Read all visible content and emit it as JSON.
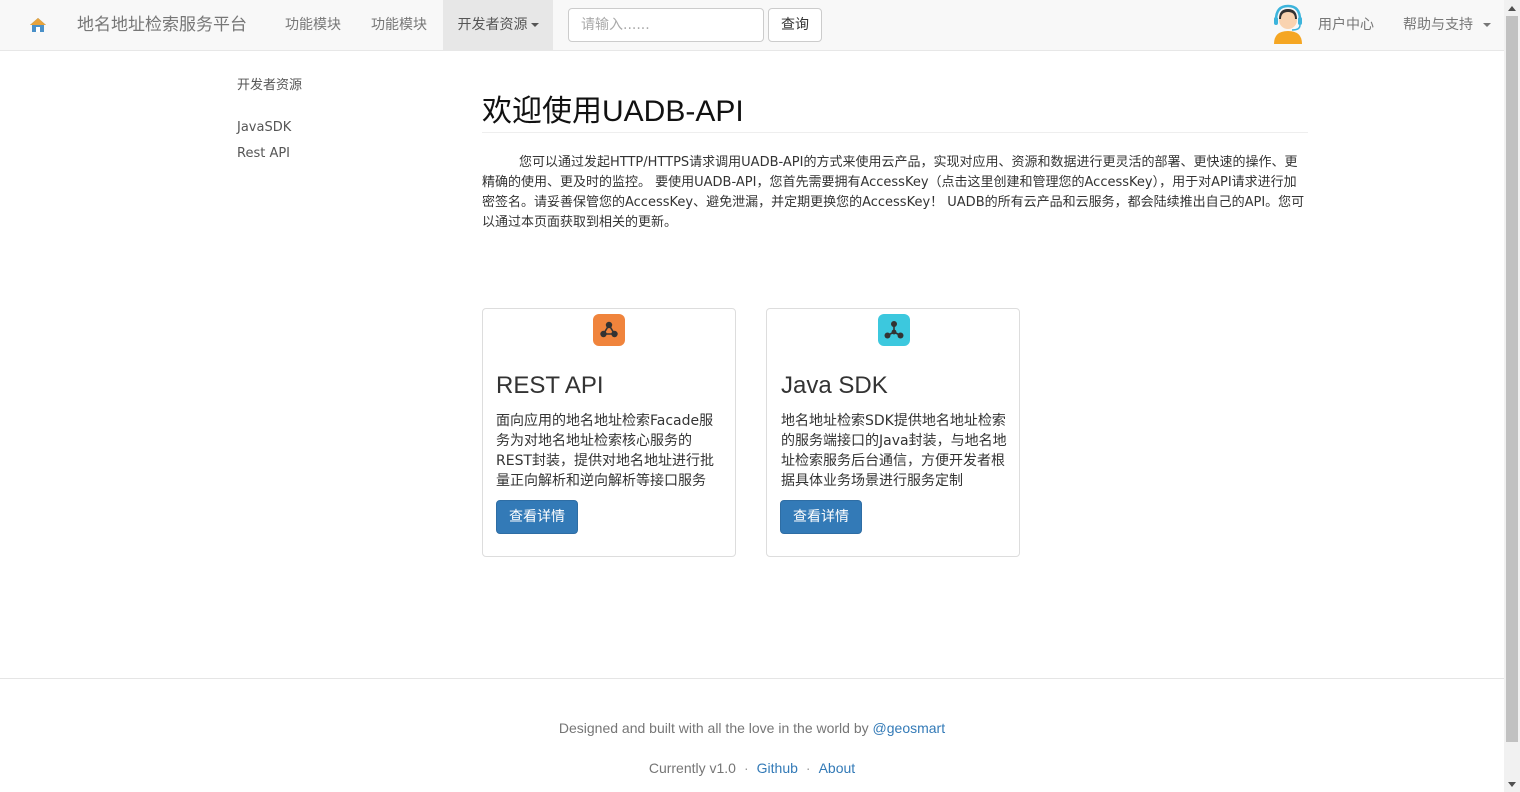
{
  "navbar": {
    "home_icon": "home-icon",
    "brand": "地名地址检索服务平台",
    "links": [
      "功能模块",
      "功能模块"
    ],
    "dev_resources": "开发者资源",
    "search_placeholder": "请输入......",
    "query_button": "查询",
    "avatar_icon": "user-support-avatar-icon",
    "user_center": "用户中心",
    "help": "帮助与支持"
  },
  "sidebar": {
    "title": "开发者资源",
    "items": [
      {
        "label": "JavaSDK"
      },
      {
        "label": "Rest API"
      }
    ]
  },
  "main": {
    "title": "欢迎使用UADB-API",
    "intro": "您可以通过发起HTTP/HTTPS请求调用UADB-API的方式来使用云产品，实现对应用、资源和数据进行更灵活的部署、更快速的操作、更精确的使用、更及时的监控。 要使用UADB-API，您首先需要拥有AccessKey（点击这里创建和管理您的AccessKey），用于对API请求进行加密签名。请妥善保管您的AccessKey、避免泄漏，并定期更换您的AccessKey！ UADB的所有云产品和云服务，都会陆续推出自己的API。您可以通过本页面获取到相关的更新。",
    "cards": [
      {
        "icon": "share-nodes-icon",
        "icon_color": "#f0843c",
        "title": "REST API",
        "desc": "面向应用的地名地址检索Facade服务为对地名地址检索核心服务的REST封装，提供对地名地址进行批量正向解析和逆向解析等接口服务",
        "button": "查看详情"
      },
      {
        "icon": "network-nodes-icon",
        "icon_color": "#3cc8de",
        "title": "Java SDK",
        "desc": "地名地址检索SDK提供地名地址检索的服务端接口的Java封装，与地名地址检索服务后台通信，方便开发者根据具体业务场景进行服务定制",
        "button": "查看详情"
      }
    ]
  },
  "footer": {
    "credit_prefix": "Designed and built with all the love in the world by ",
    "credit_handle": "@geosmart",
    "version": "Currently v1.0",
    "sep": "·",
    "github": "Github",
    "about": "About"
  },
  "colors": {
    "primary": "#337ab7",
    "navbar_bg": "#f8f8f8",
    "active_nav_bg": "#e7e7e7"
  }
}
